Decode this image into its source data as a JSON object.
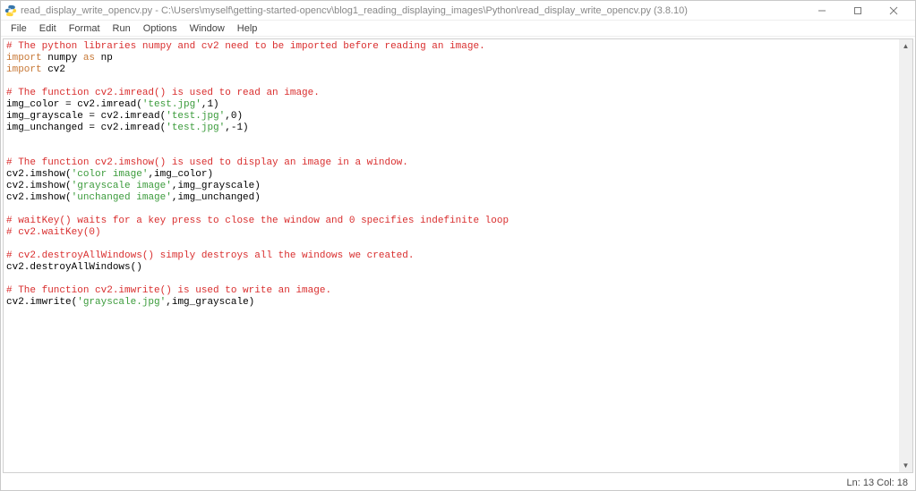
{
  "titlebar": {
    "title": "read_display_write_opencv.py - C:\\Users\\myself\\getting-started-opencv\\blog1_reading_displaying_images\\Python\\read_display_write_opencv.py (3.8.10)"
  },
  "menu": {
    "file": "File",
    "edit": "Edit",
    "format": "Format",
    "run": "Run",
    "options": "Options",
    "window": "Window",
    "help": "Help"
  },
  "code": {
    "l1": "# The python libraries numpy and cv2 need to be imported before reading an image.",
    "l2a": "import",
    "l2b": " numpy ",
    "l2c": "as",
    "l2d": " np",
    "l3a": "import",
    "l3b": " cv2",
    "l5": "# The function cv2.imread() is used to read an image.",
    "l6a": "img_color = cv2.imread(",
    "l6b": "'test.jpg'",
    "l6c": ",1)",
    "l7a": "img_grayscale = cv2.imread(",
    "l7b": "'test.jpg'",
    "l7c": ",0)",
    "l8a": "img_unchanged = cv2.imread(",
    "l8b": "'test.jpg'",
    "l8c": ",-1)",
    "l11": "# The function cv2.imshow() is used to display an image in a window.",
    "l12a": "cv2.imshow(",
    "l12b": "'color image'",
    "l12c": ",img_color)",
    "l13a": "cv2.imshow(",
    "l13b": "'grayscale image'",
    "l13c": ",img_grayscale)",
    "l14a": "cv2.imshow(",
    "l14b": "'unchanged image'",
    "l14c": ",img_unchanged)",
    "l16": "# waitKey() waits for a key press to close the window and 0 specifies indefinite loop",
    "l17": "# cv2.waitKey(0)",
    "l19": "# cv2.destroyAllWindows() simply destroys all the windows we created.",
    "l20": "cv2.destroyAllWindows()",
    "l22": "# The function cv2.imwrite() is used to write an image.",
    "l23a": "cv2.imwrite(",
    "l23b": "'grayscale.jpg'",
    "l23c": ",img_grayscale)"
  },
  "status": {
    "pos": "Ln: 13   Col: 18"
  }
}
